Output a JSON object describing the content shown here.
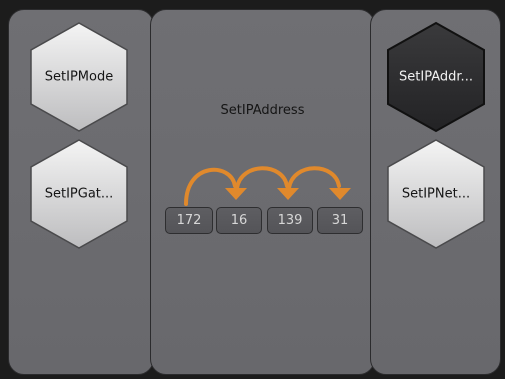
{
  "left_panel": {
    "blocks": [
      {
        "label": "SetIPMode"
      },
      {
        "label": "SetIPGat..."
      }
    ]
  },
  "center_panel": {
    "title": "SetIPAddress",
    "octets": [
      "172",
      "16",
      "139",
      "31"
    ]
  },
  "right_panel": {
    "blocks": [
      {
        "label": "SetIPAddr...",
        "selected": true
      },
      {
        "label": "SetIPNet..."
      }
    ]
  },
  "colors": {
    "panel": "#6c6c70",
    "hex_light": "#e8e8e8",
    "hex_selected": "#2f2f31",
    "arrow": "#e0892c"
  }
}
